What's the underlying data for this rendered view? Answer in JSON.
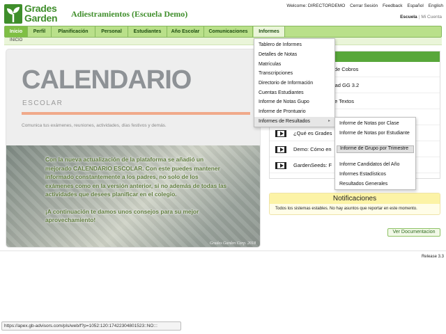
{
  "header": {
    "logo_line1": "Grades",
    "logo_line2": "Garden",
    "app_title": "Adiestramientos (Escuela Demo)",
    "welcome": "Welcome: DIRECTORDEMO",
    "logout": "Cerrar Sesión",
    "feedback": "Feedback",
    "lang_es": "Español",
    "lang_en": "English",
    "school": "Escuela",
    "account": "Mi Cuenta"
  },
  "nav": {
    "items": [
      {
        "label": "Inicio"
      },
      {
        "label": "Perfil"
      },
      {
        "label": "Planificación"
      },
      {
        "label": "Personal"
      },
      {
        "label": "Estudiantes"
      },
      {
        "label": "Año Escolar"
      },
      {
        "label": "Comunicaciones"
      },
      {
        "label": "Informes"
      }
    ],
    "breadcrumb": "INICIO"
  },
  "informes_menu": {
    "items": [
      {
        "label": "Tablero de Informes"
      },
      {
        "label": "Detalles de Notas"
      },
      {
        "label": "Matrículas"
      },
      {
        "label": "Transcripciones"
      },
      {
        "label": "Directorio de Información"
      },
      {
        "label": "Cuentas Estudiantes"
      },
      {
        "label": "Informe de Notas Gupo"
      },
      {
        "label": "Informe de Prontuario"
      },
      {
        "label": "Informes de Resultados"
      }
    ],
    "arrow": "▸"
  },
  "resultados_submenu": {
    "items": [
      {
        "label": "Informe de Notas por Clase"
      },
      {
        "label": "Informe de Notas por Estudiante"
      },
      {
        "label": "Informe de Grupo por Trimestre"
      },
      {
        "label": "Informe Candidatos del Año"
      },
      {
        "label": "Informes Estadísticos"
      },
      {
        "label": "Resultados Generales"
      }
    ]
  },
  "calendar": {
    "title": "CALENDARIO",
    "subtitle": "ESCOLAR",
    "description": "Comunica tus exámenes, reuniones, actividades, días festivos y demás.",
    "paragraph1": "Con la nueva actualización de la plataforma se añadió un mejorado CALENDARIO ESCOLAR. Con este puedes mantener informado constantemente a los padres, no solo de los exámenes como en la versión anterior, si no además de todas las actividades que desees planificar en el colegio.",
    "paragraph2": "¡A continuación te damos unos consejos para su mejor aprovechamiento!",
    "credit": "Grades Garden Corp. 2018"
  },
  "videos": {
    "title": "Videos Tutoriales",
    "items": [
      {
        "label": "Seminario Jardín de Cobros"
      },
      {
        "label": "Nueva funcionalidad GG 3.2"
      },
      {
        "label": "Usar el Sistema de Textos"
      },
      {
        "label": ""
      },
      {
        "label": "¿Qué es Grades"
      },
      {
        "label": "Demo: Cómo en"
      },
      {
        "label": "GardenSeeds: F"
      }
    ]
  },
  "notifications": {
    "title": "Notificaciones",
    "text": "Todos los sistemas estables. No hay asuntos que reportar en este momento."
  },
  "doc_button": "Ver Documentacion",
  "release": "Release 3.3",
  "statusbar": "https://apex.gb-advisors.com/pls/web/f?p=1052:120:174223048015​23::NO:::"
}
